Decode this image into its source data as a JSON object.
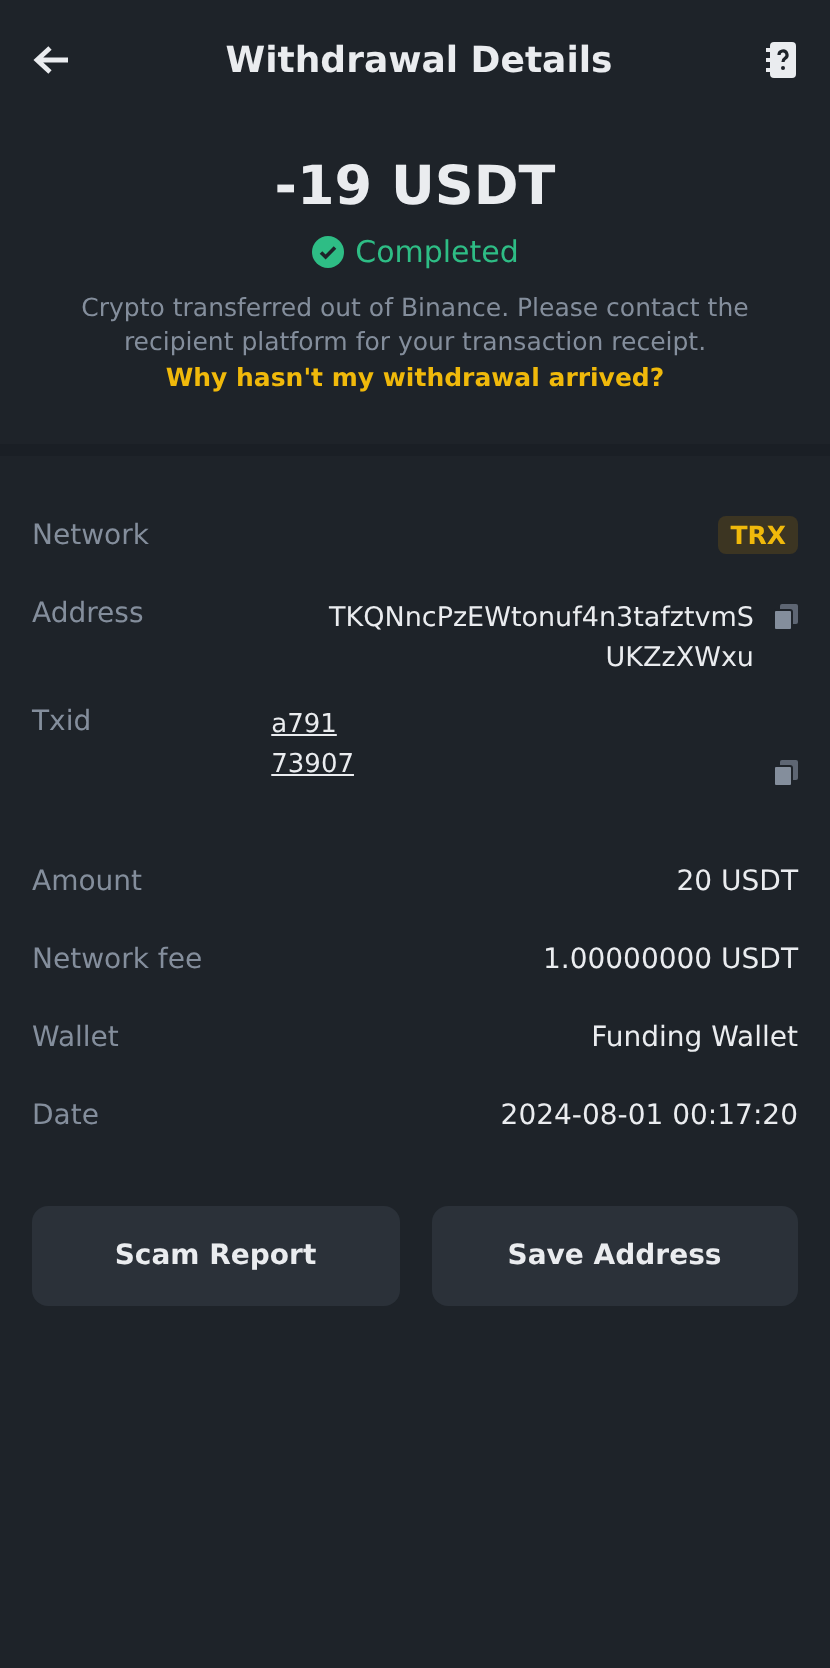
{
  "header": {
    "title": "Withdrawal Details"
  },
  "summary": {
    "amount": "-19 USDT",
    "status": "Completed",
    "completed": true,
    "note": "Crypto transferred out of Binance. Please contact the recipient platform for your transaction receipt.",
    "link": "Why hasn't my withdrawal arrived?"
  },
  "details": [
    {
      "kind": "badge",
      "label": "Network",
      "value": "TRX"
    },
    {
      "kind": "copy",
      "label": "Address",
      "value": "TKQNncPzEWtonuf4n3tafztvmSUKZzXWxu"
    },
    {
      "kind": "link",
      "label": "Txid",
      "lines": [
        "a791",
        "73907"
      ]
    },
    {
      "kind": "text",
      "label": "Amount",
      "value": "20 USDT"
    },
    {
      "kind": "text",
      "label": "Network fee",
      "value": "1.00000000 USDT"
    },
    {
      "kind": "text",
      "label": "Wallet",
      "value": "Funding Wallet"
    },
    {
      "kind": "text",
      "label": "Date",
      "value": "2024-08-01 00:17:20"
    }
  ],
  "buttons": [
    "Scam Report",
    "Save Address"
  ]
}
